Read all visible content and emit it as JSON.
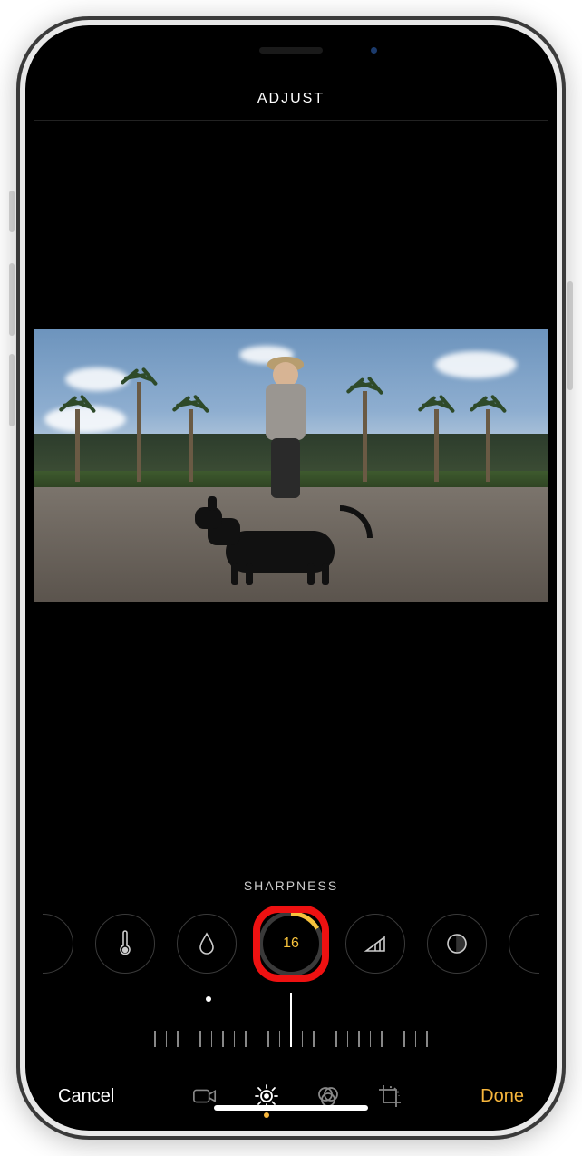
{
  "header": {
    "title": "ADJUST"
  },
  "adjust": {
    "label": "SHARPNESS",
    "value": "16",
    "tools": [
      {
        "name": "warmth-icon"
      },
      {
        "name": "tint-icon"
      },
      {
        "name": "sharpness-icon"
      },
      {
        "name": "definition-icon"
      },
      {
        "name": "noise-reduction-icon"
      }
    ]
  },
  "bottom": {
    "cancel": "Cancel",
    "done": "Done",
    "tabs": {
      "video": "video-icon",
      "adjust": "adjust-icon",
      "filters": "filters-icon",
      "crop": "crop-icon"
    }
  },
  "colors": {
    "accent": "#f7b63c",
    "highlight": "#e11"
  }
}
